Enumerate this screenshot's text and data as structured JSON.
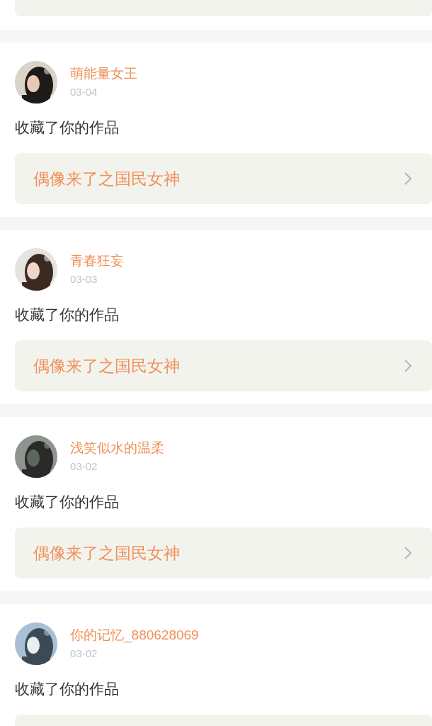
{
  "notifications": [
    {
      "user": "萌能量女王",
      "date": "03-04",
      "action": "收藏了你的作品",
      "work": "偶像来了之国民女神"
    },
    {
      "user": "青春狂妄",
      "date": "03-03",
      "action": "收藏了你的作品",
      "work": "偶像来了之国民女神"
    },
    {
      "user": "浅笑似水的温柔",
      "date": "03-02",
      "action": "收藏了你的作品",
      "work": "偶像来了之国民女神"
    },
    {
      "user": "你的记忆_880628069",
      "date": "03-02",
      "action": "收藏了你的作品"
    }
  ]
}
